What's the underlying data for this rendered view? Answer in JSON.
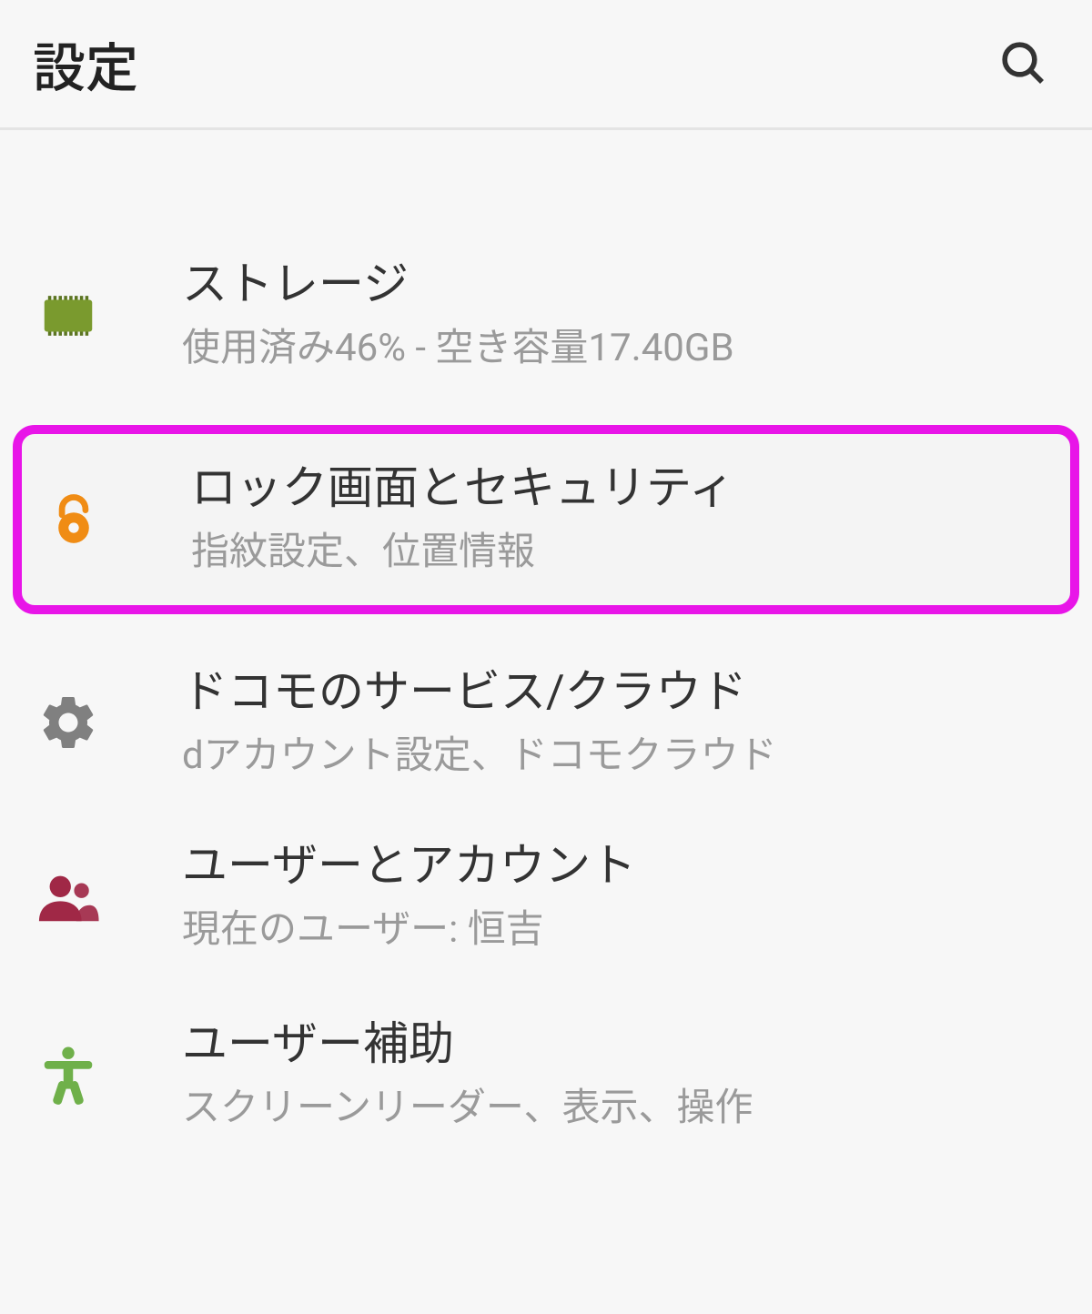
{
  "header": {
    "title": "設定"
  },
  "items": {
    "storage": {
      "title": "ストレージ",
      "subtitle": "使用済み46% - 空き容量17.40GB"
    },
    "security": {
      "title": "ロック画面とセキュリティ",
      "subtitle": "指紋設定、位置情報"
    },
    "docomo": {
      "title": "ドコモのサービス/クラウド",
      "subtitle": "dアカウント設定、ドコモクラウド"
    },
    "users": {
      "title": "ユーザーとアカウント",
      "subtitle": "現在のユーザー: 恒吉"
    },
    "accessibility": {
      "title": "ユーザー補助",
      "subtitle": "スクリーンリーダー、表示、操作"
    }
  },
  "colors": {
    "highlight": "#e815e8",
    "storage_icon": "#7a9a2e",
    "security_icon": "#f08c14",
    "gear_icon": "#808080",
    "users_icon": "#a02846",
    "accessibility_icon": "#6fb04a"
  }
}
